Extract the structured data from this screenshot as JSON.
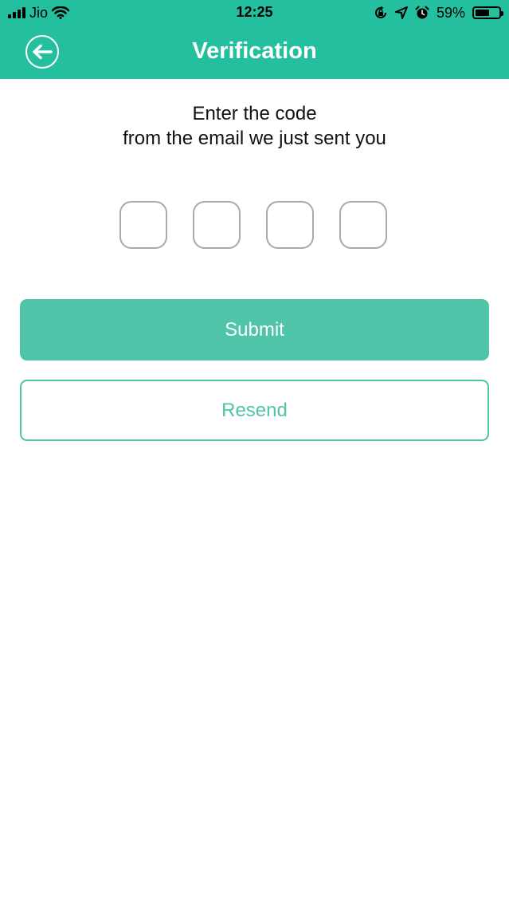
{
  "status_bar": {
    "carrier": "Jio",
    "time": "12:25",
    "battery_percent": "59%",
    "battery_level": 0.59,
    "icons": [
      "signal-icon",
      "wifi-icon",
      "orientation-lock-icon",
      "location-arrow-icon",
      "alarm-icon",
      "battery-icon"
    ]
  },
  "header": {
    "title": "Verification",
    "back_icon": "back-arrow-icon",
    "background_color": "#24bf9f"
  },
  "instructions": {
    "line1": "Enter the code",
    "line2": "from the email we just sent you"
  },
  "code_inputs": [
    {
      "value": ""
    },
    {
      "value": ""
    },
    {
      "value": ""
    },
    {
      "value": ""
    }
  ],
  "buttons": {
    "submit_label": "Submit",
    "resend_label": "Resend",
    "accent_color": "#4fc4a8"
  }
}
